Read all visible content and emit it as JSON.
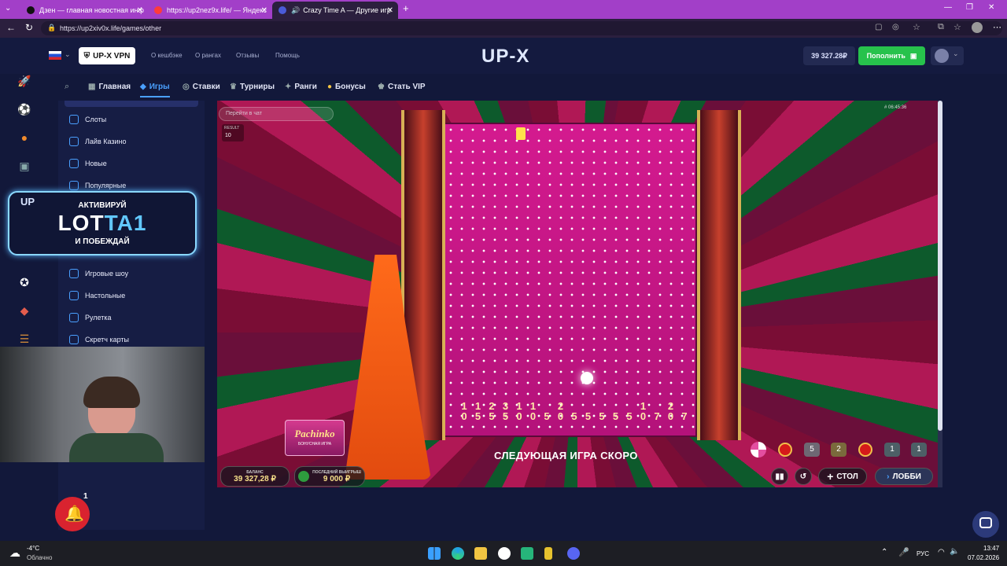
{
  "browser": {
    "tabs": [
      {
        "label": "Дзен — главная новостная инф",
        "active": false
      },
      {
        "label": "https://up2nez9x.life/ — Яндекс",
        "active": false
      },
      {
        "label": "Crazy Time A — Другие игр",
        "active": true
      }
    ],
    "url": "https://up2xiv0x.life/games/other"
  },
  "header": {
    "vpn_label": "UP-X VPN",
    "links": [
      "О кешбэке",
      "О рангах",
      "Отзывы",
      "Помощь"
    ],
    "logo": "UP-X",
    "balance": "39 327.28₽",
    "deposit_label": "Пополнить"
  },
  "nav": {
    "items": [
      "Главная",
      "Игры",
      "Ставки",
      "Турниры",
      "Ранги",
      "Бонусы",
      "Стать VIP"
    ]
  },
  "sidebar": {
    "items_top": [
      "Слоты",
      "Лайв Казино",
      "Новые",
      "Популярные"
    ],
    "items_bottom": [
      "Игровые шоу",
      "Настольные",
      "Рулетка",
      "Скретч карты"
    ]
  },
  "promo": {
    "badge": "UP",
    "line1": "АКТИВИРУЙ",
    "code_white": "LOT",
    "code_accent": "TA1",
    "line3": "И ПОБЕЖДАЙ"
  },
  "game": {
    "chat_placeholder": "Перейти в чат",
    "result_label": "RESULT",
    "result_value": "10",
    "timestamp": "# 06:45:36",
    "status_text": "СЛЕДУЮЩАЯ ИГРА СКОРО",
    "pachinko_title": "Pachinko",
    "pachinko_sub": "БОНУСНАЯ ИГРА",
    "balance_label": "БАЛАНС",
    "balance_value": "39 327,28 ₽",
    "last_win_label": "ПОСЛЕДНИЙ ВЫИГРЫШ",
    "last_win_value": "9 000 ₽",
    "table_button": "СТОЛ",
    "lobby_button": "ЛОББИ",
    "history": [
      "5",
      "2",
      "1",
      "1"
    ],
    "multipliers_top": [
      "1",
      "1",
      "2",
      "3",
      "1",
      "1",
      "",
      "2",
      "",
      "",
      "",
      "",
      "",
      "1",
      "",
      "2",
      ""
    ],
    "multipliers_bottom": [
      "0",
      "5",
      "5",
      "5",
      "0",
      "0",
      "5",
      "0",
      "5",
      "5",
      "5",
      "5",
      "5",
      "0",
      "7",
      "0",
      "7"
    ]
  },
  "notifications": {
    "bell_count": "1"
  },
  "taskbar": {
    "weather_temp": "-4°C",
    "weather_desc": "Облачно",
    "lang": "РУС",
    "time": "13:47",
    "date": "07.02.2026"
  },
  "colors": {
    "tabbar": "#a23fc8",
    "accent_green": "#27c24c",
    "accent_blue": "#4aa0ff",
    "promo_accent": "#62c8ff",
    "bell_red": "#d9232f"
  }
}
